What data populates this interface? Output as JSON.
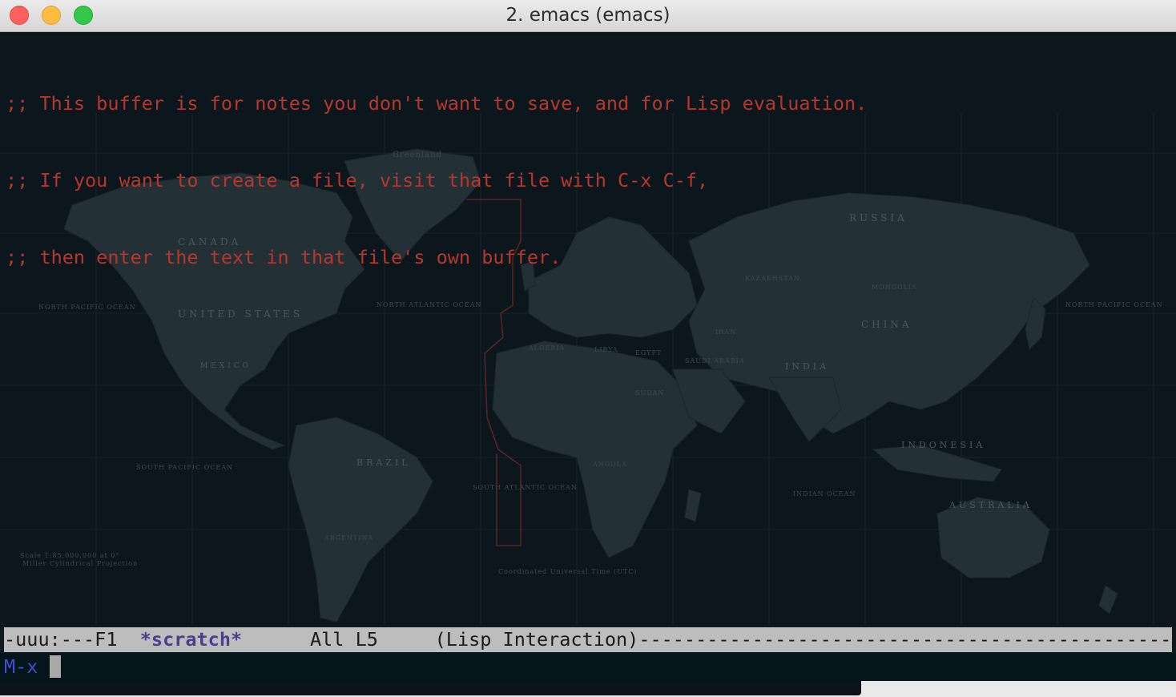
{
  "window": {
    "title": "2. emacs (emacs)",
    "controls": [
      "close",
      "minimize",
      "zoom"
    ]
  },
  "buffer": {
    "lines": [
      ";; This buffer is for notes you don't want to save, and for Lisp evaluation.",
      ";; If you want to create a file, visit that file with C-x C-f,",
      ";; then enter the text in that file's own buffer."
    ],
    "comment_color": "#b8362b",
    "background_color": "#0e1a1f",
    "background_image": {
      "description_icon": "world-map-background",
      "labels": {
        "canada": "CANADA",
        "united_states": "UNITED STATES",
        "mexico": "MEXICO",
        "brazil": "BRAZIL",
        "russia": "RUSSIA",
        "china": "CHINA",
        "india": "INDIA",
        "indonesia": "INDONESIA",
        "australia": "AUSTRALIA",
        "greenland": "Greenland",
        "north_atlantic": "NORTH ATLANTIC OCEAN",
        "south_atlantic": "SOUTH ATLANTIC OCEAN",
        "north_pacific_east": "NORTH PACIFIC OCEAN",
        "north_pacific_west": "NORTH PACIFIC OCEAN",
        "south_pacific": "SOUTH PACIFIC OCEAN",
        "indian_ocean": "INDIAN OCEAN",
        "algeria": "ALGERIA",
        "libya": "LIBYA",
        "egypt": "EGYPT",
        "sudan": "SUDAN",
        "saudi_arabia": "SAUDI ARABIA",
        "iran": "IRAN",
        "mongolia": "MONGOLIA",
        "kazakhstan": "KAZAKHSTAN",
        "argentina": "ARGENTINA",
        "angola": "ANGOLA",
        "scale": "Scale 1:85,000,000 at 0°",
        "projection": "Miller Cylindrical Projection",
        "utc": "Coordinated Universal Time (UTC)"
      }
    }
  },
  "modeline": {
    "status": "-uuu:---F1  ",
    "buffer_name": "*scratch*",
    "position": "      All L5     ",
    "mode": "(Lisp Interaction)",
    "fill": "------------------------------------------------------------",
    "background_color": "#bdbdbd"
  },
  "minibuffer": {
    "prompt": "M-x",
    "prompt_color": "#3a4fd6"
  }
}
